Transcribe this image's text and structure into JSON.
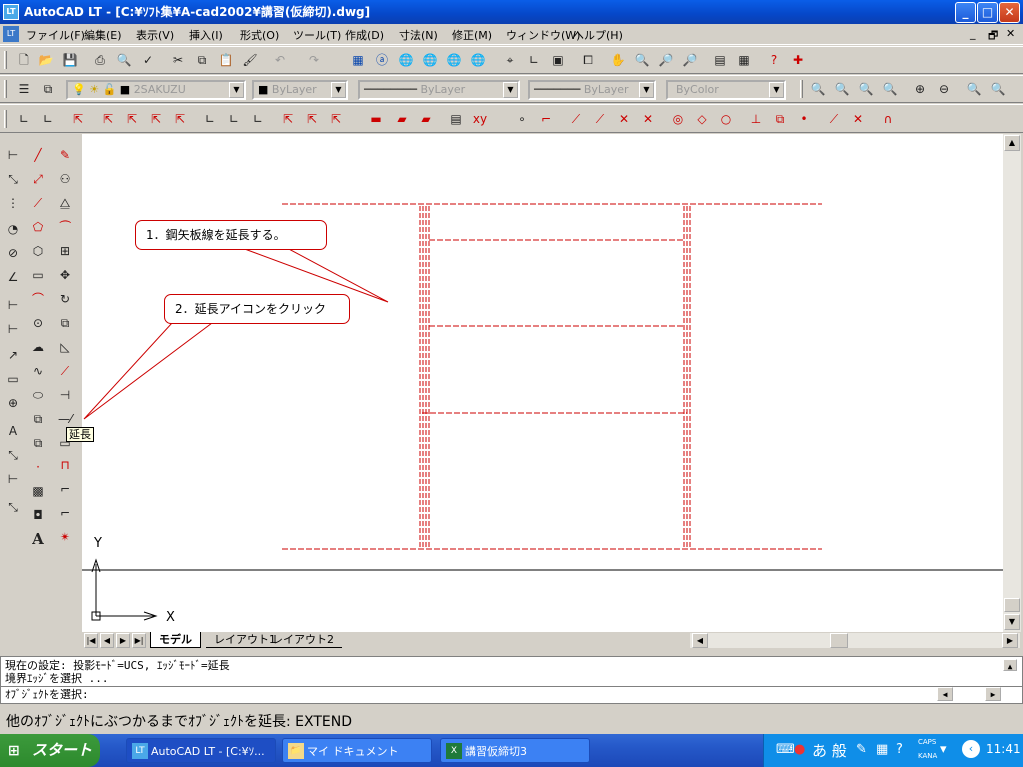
{
  "window": {
    "app_icon": "LT",
    "title": "AutoCAD LT - [C:¥ｿﾌﾄ集¥A-cad2002¥講習(仮締切).dwg]",
    "min": "_",
    "max": "□",
    "close": "✕"
  },
  "menu": {
    "items": [
      "ファイル(F)",
      "編集(E)",
      "表示(V)",
      "挿入(I)",
      "形式(O)",
      "ツール(T)",
      "作成(D)",
      "寸法(N)",
      "修正(M)",
      "ウィンドウ(W)",
      "ヘルプ(H)"
    ],
    "mdi": [
      "_",
      "🗗",
      "✕"
    ]
  },
  "toolbar_layers": {
    "layer_name": "2SAKUZU",
    "color": "ByLayer",
    "linetype": "ByLayer",
    "lineweight": "ByLayer",
    "plotstyle": "ByColor"
  },
  "callouts": [
    {
      "text": "1．鋼矢板線を延長する。"
    },
    {
      "text": "2．延長アイコンをクリック"
    }
  ],
  "tooltip": "延長",
  "ucs": {
    "y": "Y",
    "x": "X"
  },
  "tabs": [
    "モデル",
    "レイアウト1",
    "レイアウト2"
  ],
  "command": {
    "line1": "現在の設定: 投影ﾓｰﾄﾞ=UCS, ｴｯｼﾞﾓｰﾄﾞ=延長",
    "line2": "境界ｴｯｼﾞを選択 ...",
    "line3": "ｵﾌﾞｼﾞｪｸﾄを選択:"
  },
  "status": "他のｵﾌﾞｼﾞｪｸﾄにぶつかるまでｵﾌﾞｼﾞｪｸﾄを延長:  EXTEND",
  "taskbar": {
    "start": "スタート",
    "tasks": [
      {
        "label": "AutoCAD LT - [C:¥ｿ...",
        "icon": "LT"
      },
      {
        "label": "マイ ドキュメント",
        "icon": "📁"
      },
      {
        "label": "講習仮締切3",
        "icon": "X"
      }
    ],
    "ime": "あ 般",
    "caps": "CAPS",
    "kana": "KANA",
    "clock": "11:41"
  },
  "colors": {
    "drawing_red": "#cc0000",
    "title_blue": "#0a5ee8",
    "taskbar_blue": "#2558c8",
    "start_green": "#3c9a3c"
  }
}
